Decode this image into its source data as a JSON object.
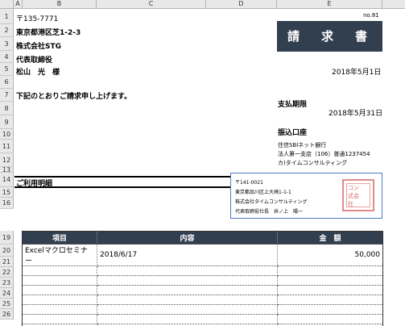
{
  "columns": [
    "A",
    "B",
    "C",
    "D",
    "E"
  ],
  "rows": [
    "1",
    "2",
    "3",
    "4",
    "5",
    "6",
    "7",
    "8",
    "9",
    "10",
    "11",
    "12",
    "13",
    "14",
    "15",
    "16",
    "19",
    "20",
    "21",
    "22",
    "23",
    "24",
    "25",
    "26"
  ],
  "doc_no": "no.81",
  "recipient": {
    "postal": "〒135-7771",
    "address": "東京都港区芝1-2-3",
    "company": "株式会社STG",
    "title": "代表取締役",
    "name": "松山　光　様"
  },
  "doc_title": "請　求　書",
  "issue_date": "2018年5月1日",
  "intro": "下記のとおりご請求申し上げます。",
  "payment": {
    "deadline_label": "支払期限",
    "deadline_date": "2018年5月31日",
    "account_label": "振込口座",
    "bank": "住信SBIネット銀行",
    "branch": "法人第一支店（106）普通1237454",
    "holder": "カ)タイムコンサルティング"
  },
  "section_title": "ご利用明細",
  "issuer": {
    "postal": "〒141-0021",
    "address": "東京都品川区上大崎1-1-1",
    "company": "株式会社タイムコンサルティング",
    "rep": "代表取締役社長　井ノ上　陽一",
    "seal_text": [
      "コン",
      "式会",
      "社"
    ]
  },
  "table": {
    "headers": [
      "項目",
      "内容",
      "金　額"
    ],
    "rows": [
      [
        "Excelマクロセミナー",
        "2018/6/17",
        "50,000"
      ],
      [
        "",
        "",
        ""
      ],
      [
        "",
        "",
        ""
      ],
      [
        "",
        "",
        ""
      ],
      [
        "",
        "",
        ""
      ],
      [
        "",
        "",
        ""
      ],
      [
        "",
        "",
        ""
      ],
      [
        "",
        "",
        ""
      ]
    ]
  }
}
